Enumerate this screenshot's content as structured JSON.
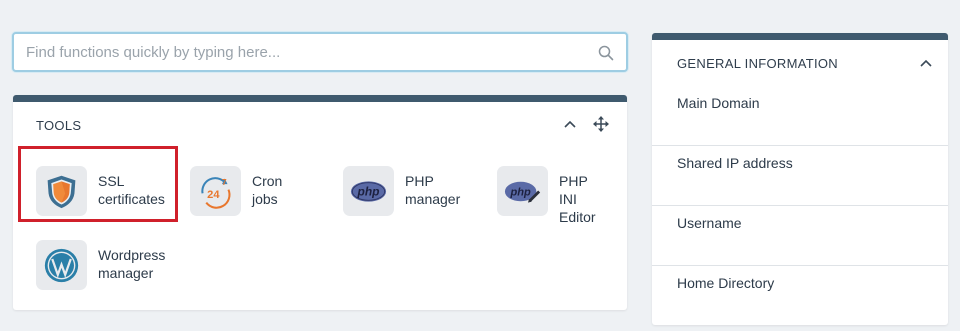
{
  "search": {
    "placeholder": "Find functions quickly by typing here..."
  },
  "tools": {
    "title": "TOOLS",
    "items": [
      {
        "label": "SSL\ncertificates",
        "icon": "ssl-shield-icon"
      },
      {
        "label": "Cron\njobs",
        "icon": "cron-jobs-icon"
      },
      {
        "label": "PHP\nmanager",
        "icon": "php-icon"
      },
      {
        "label": "PHP\nINI\nEditor",
        "icon": "php-ini-editor-icon"
      },
      {
        "label": "Wordpress\nmanager",
        "icon": "wordpress-icon"
      }
    ]
  },
  "info": {
    "title": "GENERAL INFORMATION",
    "rows": [
      {
        "label": "Main Domain"
      },
      {
        "label": "Shared IP address"
      },
      {
        "label": "Username"
      },
      {
        "label": "Home Directory"
      }
    ]
  },
  "colors": {
    "accent_bar": "#3f5a6e",
    "highlight": "#d0202b",
    "search_border": "#9ecde3"
  }
}
